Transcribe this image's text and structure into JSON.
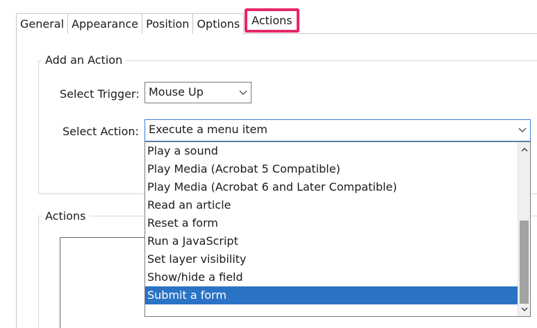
{
  "tabs": [
    {
      "label": "General"
    },
    {
      "label": "Appearance"
    },
    {
      "label": "Position"
    },
    {
      "label": "Options"
    },
    {
      "label": "Actions",
      "active": true
    }
  ],
  "add_action": {
    "title": "Add an Action",
    "trigger_label": "Select Trigger:",
    "trigger_value": "Mouse Up",
    "action_label": "Select Action:",
    "action_value": "Execute a menu item"
  },
  "action_options": [
    {
      "label": "Play a sound"
    },
    {
      "label": "Play Media (Acrobat 5 Compatible)"
    },
    {
      "label": "Play Media (Acrobat 6 and Later Compatible)"
    },
    {
      "label": "Read an article"
    },
    {
      "label": "Reset a form"
    },
    {
      "label": "Run a JavaScript"
    },
    {
      "label": "Set layer visibility"
    },
    {
      "label": "Show/hide a field"
    },
    {
      "label": "Submit a form",
      "selected": true
    }
  ],
  "actions_group": {
    "title": "Actions"
  },
  "colors": {
    "highlight": "#e8246c",
    "selection": "#2a73c5"
  }
}
